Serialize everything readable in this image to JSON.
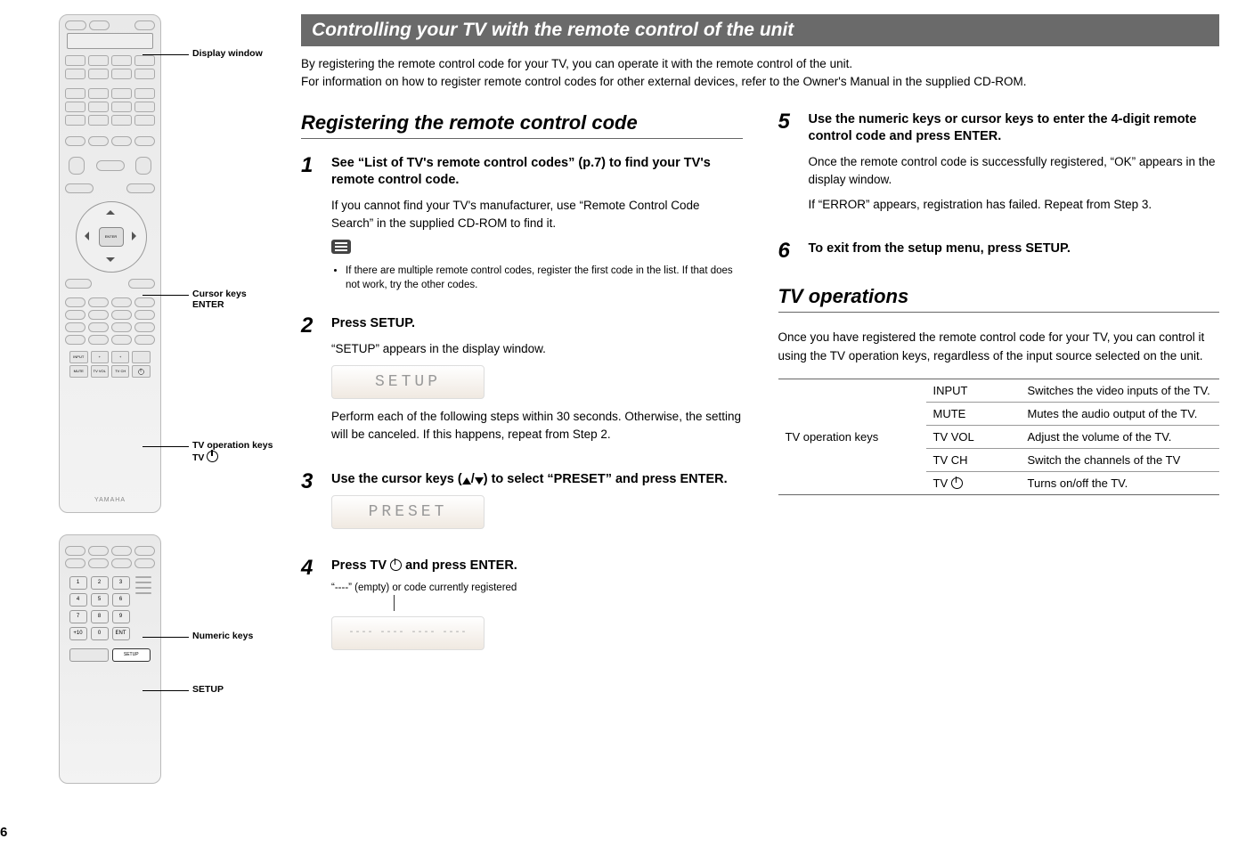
{
  "page_number": "6",
  "banner": "Controlling your TV with the remote control of the unit",
  "intro_lines": [
    "By registering the remote control code for your TV, you can operate it with the remote control of the unit.",
    "For information on how to register remote control codes for other external devices, refer to the Owner's Manual in the supplied CD-ROM."
  ],
  "section_a": {
    "heading": "Registering the remote control code",
    "steps": {
      "s1": {
        "no": "1",
        "title": "See “List of TV's remote control codes” (p.7) to find your TV's remote control code.",
        "text": "If you cannot find your TV's manufacturer, use “Remote Control Code Search” in the supplied CD-ROM to find it.",
        "note": "If there are multiple remote control codes, register the first code in the list. If that does not work, try the other codes."
      },
      "s2": {
        "no": "2",
        "title": "Press SETUP.",
        "line1": "“SETUP” appears in the display window.",
        "lcd": "SETUP",
        "text": "Perform each of the following steps within 30 seconds. Otherwise, the setting will be canceled. If this happens, repeat from Step 2."
      },
      "s3": {
        "no": "3",
        "title_prefix": "Use the cursor keys (",
        "title_suffix": ") to select “PRESET” and press ENTER.",
        "lcd": "PRESET"
      },
      "s4": {
        "no": "4",
        "title_prefix": "Press TV ",
        "title_suffix": " and press ENTER.",
        "caption": "“----” (empty) or code currently registered"
      },
      "s5": {
        "no": "5",
        "title": "Use the numeric keys or cursor keys to enter the 4-digit remote control code and press ENTER.",
        "line1": "Once the remote control code is successfully registered, “OK” appears in the display window.",
        "line2": "If “ERROR” appears, registration has failed. Repeat from Step 3."
      },
      "s6": {
        "no": "6",
        "title": "To exit from the setup menu, press SETUP."
      }
    }
  },
  "section_b": {
    "heading": "TV operations",
    "intro": "Once you have registered the remote control code for your TV, you can control it using the TV operation keys, regardless of the input source selected on the unit.",
    "row_header": "TV operation keys",
    "rows": [
      {
        "key": "INPUT",
        "desc": "Switches the video inputs of the TV."
      },
      {
        "key": "MUTE",
        "desc": "Mutes the audio output of the TV."
      },
      {
        "key": "TV VOL",
        "desc": "Adjust the volume of the TV."
      },
      {
        "key": "TV CH",
        "desc": "Switch the channels of the TV"
      },
      {
        "key": "TV_POWER",
        "desc": "Turns on/off the TV."
      }
    ]
  },
  "remote_labels": {
    "display_window": "Display window",
    "cursor": "Cursor keys\nENTER",
    "tv_ops": "TV operation keys\nTV ",
    "numeric": "Numeric keys",
    "setup": "SETUP",
    "enter_btn": "ENTER",
    "brand": "YAMAHA",
    "tvcell_input": "INPUT",
    "tvcell_mute": "MUTE",
    "tvcell_vol": "TV VOL",
    "tvcell_ch": "TV CH",
    "setup_btn": "SETUP"
  },
  "slash": "/"
}
